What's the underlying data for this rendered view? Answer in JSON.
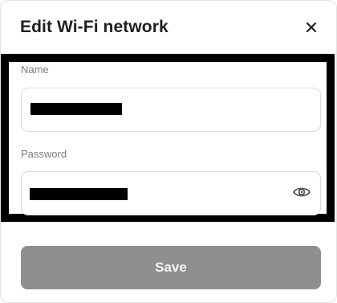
{
  "dialog": {
    "title": "Edit Wi-Fi network",
    "close_icon": "close-icon",
    "close_symbol": "×"
  },
  "form": {
    "name": {
      "label": "Name",
      "value_redacted": true
    },
    "password": {
      "label": "Password",
      "value_redacted": true,
      "toggle_icon": "eye-icon"
    }
  },
  "actions": {
    "save_label": "Save",
    "save_enabled": false
  },
  "colors": {
    "title": "#1f1f1f",
    "label": "#7a7a7a",
    "field_border": "#d9d9d9",
    "redaction": "#000000",
    "save_bg_disabled": "#8f8f8f",
    "save_text": "#f4f4f4"
  }
}
